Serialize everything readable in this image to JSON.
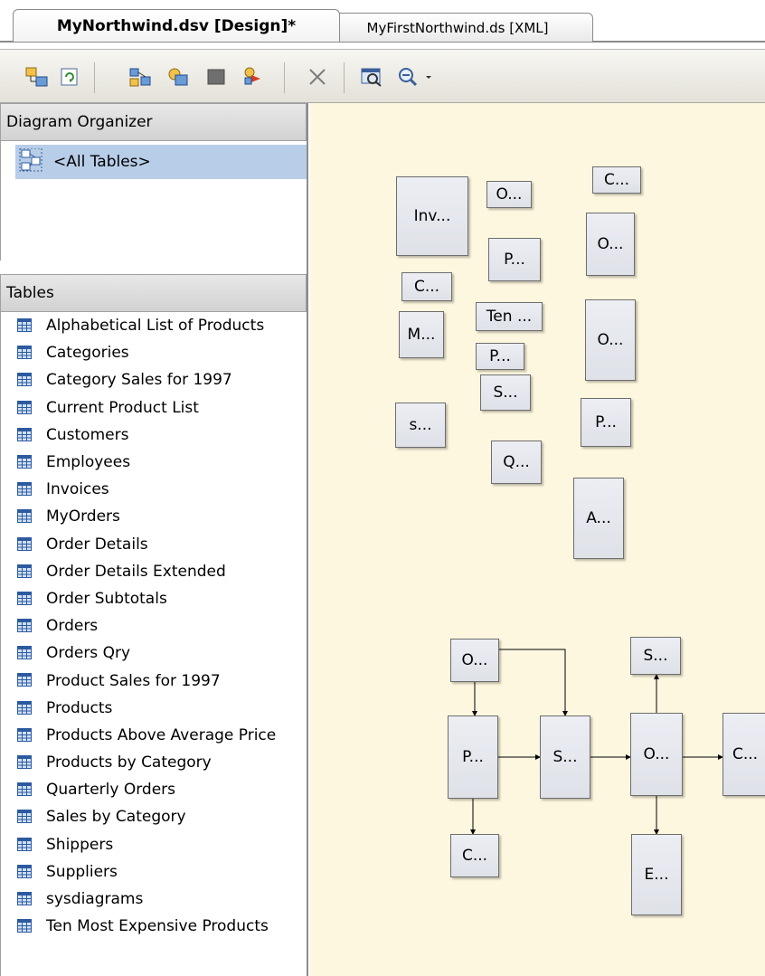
{
  "tabs": [
    {
      "label": "MyNorthwind.dsv [Design]*",
      "active": true
    },
    {
      "label": "MyFirstNorthwind.ds [XML]",
      "active": false
    }
  ],
  "toolbar": {
    "buttons": [
      "add-remove-tables-icon",
      "refresh-icon",
      "new-named-query-icon",
      "new-named-calculation-icon",
      "new-relationship-icon",
      "replace-table-icon",
      "delete-icon",
      "find-table-icon",
      "zoom-icon",
      "zoom-dropdown-icon"
    ]
  },
  "diagram_organizer": {
    "title": "Diagram Organizer",
    "items": [
      {
        "label": "<All Tables>",
        "selected": true
      }
    ]
  },
  "tables_pane": {
    "title": "Tables",
    "items": [
      "Alphabetical List of Products",
      "Categories",
      "Category Sales for 1997",
      "Current Product List",
      "Customers",
      "Employees",
      "Invoices",
      "MyOrders",
      "Order Details",
      "Order Details Extended",
      "Order Subtotals",
      "Orders",
      "Orders Qry",
      "Product Sales for 1997",
      "Products",
      "Products Above Average Price",
      "Products by Category",
      "Quarterly Orders",
      "Sales by Category",
      "Shippers",
      "Suppliers",
      "sysdiagrams",
      "Ten Most Expensive Products"
    ]
  },
  "canvas": {
    "background": "#fdf7df",
    "tables": [
      {
        "id": "inv",
        "label": "Inv..."
      },
      {
        "id": "o1",
        "label": "O..."
      },
      {
        "id": "c1",
        "label": "C..."
      },
      {
        "id": "p1",
        "label": "P..."
      },
      {
        "id": "o2",
        "label": "O..."
      },
      {
        "id": "c2",
        "label": "C..."
      },
      {
        "id": "ten",
        "label": "Ten ..."
      },
      {
        "id": "m",
        "label": "M..."
      },
      {
        "id": "p2",
        "label": "P..."
      },
      {
        "id": "o3",
        "label": "O..."
      },
      {
        "id": "s1",
        "label": "S..."
      },
      {
        "id": "s2",
        "label": "s..."
      },
      {
        "id": "p3",
        "label": "P..."
      },
      {
        "id": "q",
        "label": "Q..."
      },
      {
        "id": "a",
        "label": "A..."
      },
      {
        "id": "o4",
        "label": "O..."
      },
      {
        "id": "s3",
        "label": "S..."
      },
      {
        "id": "p4",
        "label": "P..."
      },
      {
        "id": "s4",
        "label": "S..."
      },
      {
        "id": "o5",
        "label": "O..."
      },
      {
        "id": "c3",
        "label": "C..."
      },
      {
        "id": "c4",
        "label": "C..."
      },
      {
        "id": "e",
        "label": "E..."
      }
    ]
  }
}
